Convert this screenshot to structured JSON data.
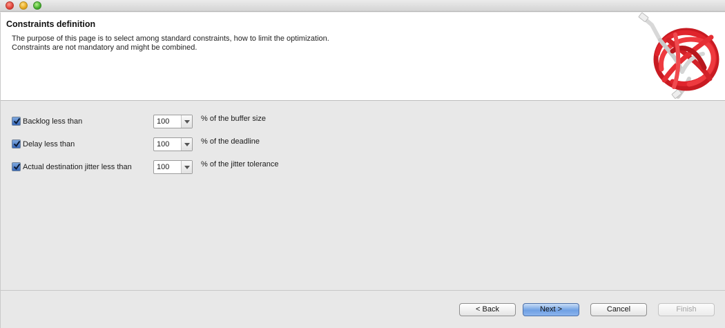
{
  "window": {
    "buttons": [
      "close",
      "minimize",
      "maximize"
    ]
  },
  "header": {
    "title": "Constraints definition",
    "description_line1": "The purpose of this page is to select among standard constraints, how to limit the optimization.",
    "description_line2": "Constraints are not mandatory and might be combined.",
    "logo_icon": "tangled-red-cable-icon"
  },
  "constraints": [
    {
      "label": "Backlog less than",
      "checked": true,
      "value": "100",
      "suffix": "% of the buffer size"
    },
    {
      "label": "Delay less than",
      "checked": true,
      "value": "100",
      "suffix": "% of the deadline"
    },
    {
      "label": "Actual destination jitter less than",
      "checked": true,
      "value": "100",
      "suffix": "% of the jitter tolerance"
    }
  ],
  "footer": {
    "back": "< Back",
    "next": "Next >",
    "cancel": "Cancel",
    "finish": "Finish"
  },
  "colors": {
    "accent": "#6fa0e3",
    "header_bg": "#ffffff",
    "body_bg": "#e8e8e8",
    "logo_red": "#e0242c"
  }
}
